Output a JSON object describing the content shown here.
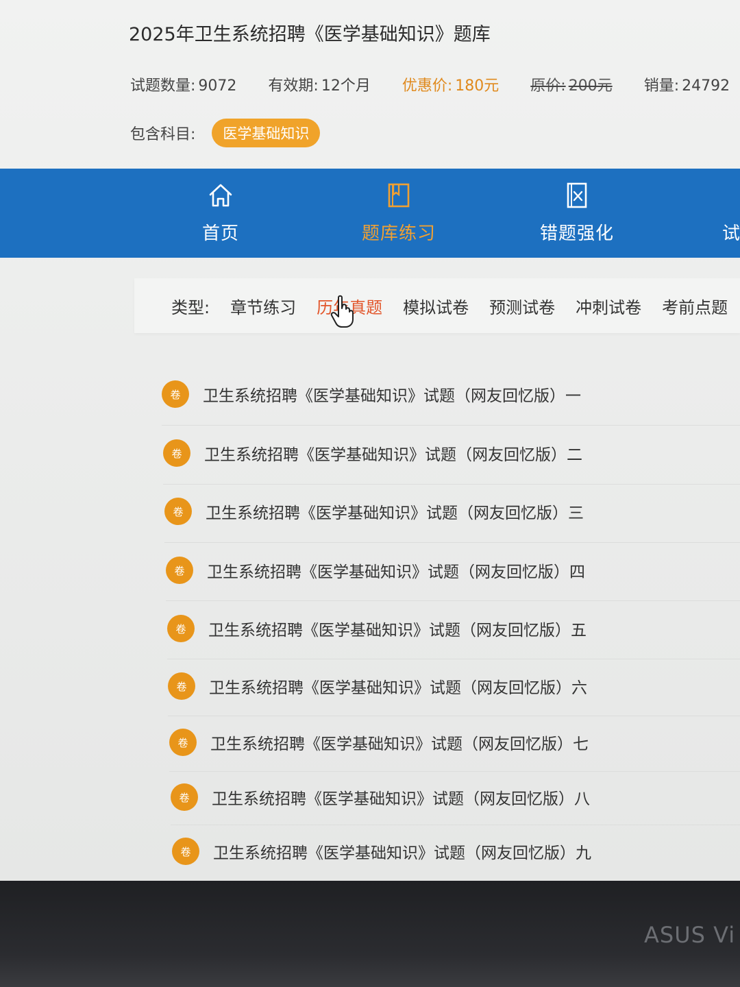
{
  "header": {
    "title": "2025年卫生系统招聘《医学基础知识》题库",
    "count_label": "试题数量:",
    "count_value": "9072",
    "validity_label": "有效期:",
    "validity_value": "12个月",
    "price_label": "优惠价:",
    "price_value": "180元",
    "orig_label": "原价:",
    "orig_value": "200元",
    "sales_label": "销量:",
    "sales_value": "24792",
    "subject_label": "包含科目:",
    "subject_tag": "医学基础知识"
  },
  "nav": {
    "items": [
      {
        "label": "首页",
        "icon": "home-icon"
      },
      {
        "label": "题库练习",
        "icon": "book-icon",
        "active": true
      },
      {
        "label": "错题强化",
        "icon": "wrong-book-icon"
      },
      {
        "label": "试"
      }
    ]
  },
  "filter": {
    "label": "类型:",
    "options": [
      "章节练习",
      "历年真题",
      "模拟试卷",
      "预测试卷",
      "冲刺试卷",
      "考前点题"
    ],
    "selected": "历年真题"
  },
  "list": {
    "badge": "卷",
    "items": [
      "卫生系统招聘《医学基础知识》试题（网友回忆版）一",
      "卫生系统招聘《医学基础知识》试题（网友回忆版）二",
      "卫生系统招聘《医学基础知识》试题（网友回忆版）三",
      "卫生系统招聘《医学基础知识》试题（网友回忆版）四",
      "卫生系统招聘《医学基础知识》试题（网友回忆版）五",
      "卫生系统招聘《医学基础知识》试题（网友回忆版）六",
      "卫生系统招聘《医学基础知识》试题（网友回忆版）七",
      "卫生系统招聘《医学基础知识》试题（网友回忆版）八",
      "卫生系统招聘《医学基础知识》试题（网友回忆版）九"
    ]
  },
  "device": {
    "brand": "ASUS Vi"
  },
  "colors": {
    "nav_bg": "#1d70c0",
    "accent_orange": "#f0a32a",
    "selected_red": "#e2552a"
  }
}
